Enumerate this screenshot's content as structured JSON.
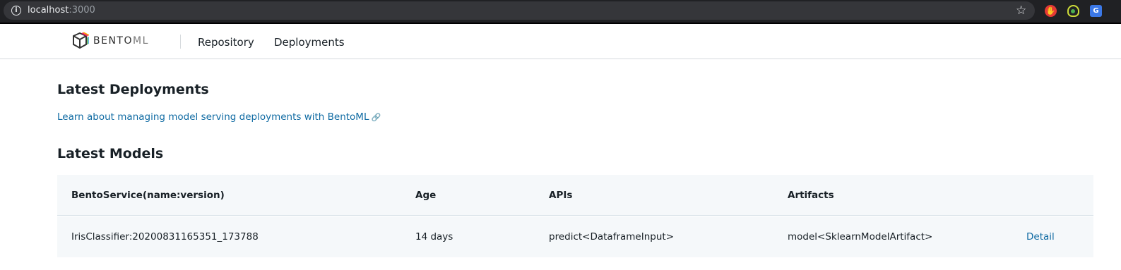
{
  "browser": {
    "url_host": "localhost",
    "url_port": ":3000"
  },
  "nav": {
    "brand_main": "BENTO",
    "brand_suffix": "ML",
    "links": [
      "Repository",
      "Deployments"
    ]
  },
  "deployments": {
    "title": "Latest Deployments",
    "learn_link": "Learn about managing model serving deployments with BentoML"
  },
  "models": {
    "title": "Latest Models",
    "columns": [
      "BentoService(name:version)",
      "Age",
      "APIs",
      "Artifacts"
    ],
    "rows": [
      {
        "service": "IrisClassifier:20200831165351_173788",
        "age": "14 days",
        "apis": "predict<DataframeInput>",
        "artifacts": "model<SklearnModelArtifact>",
        "action": "Detail"
      }
    ]
  },
  "colors": {
    "link": "#106ba3",
    "table_bg": "#f5f8fa",
    "chrome_bg": "#202124"
  }
}
